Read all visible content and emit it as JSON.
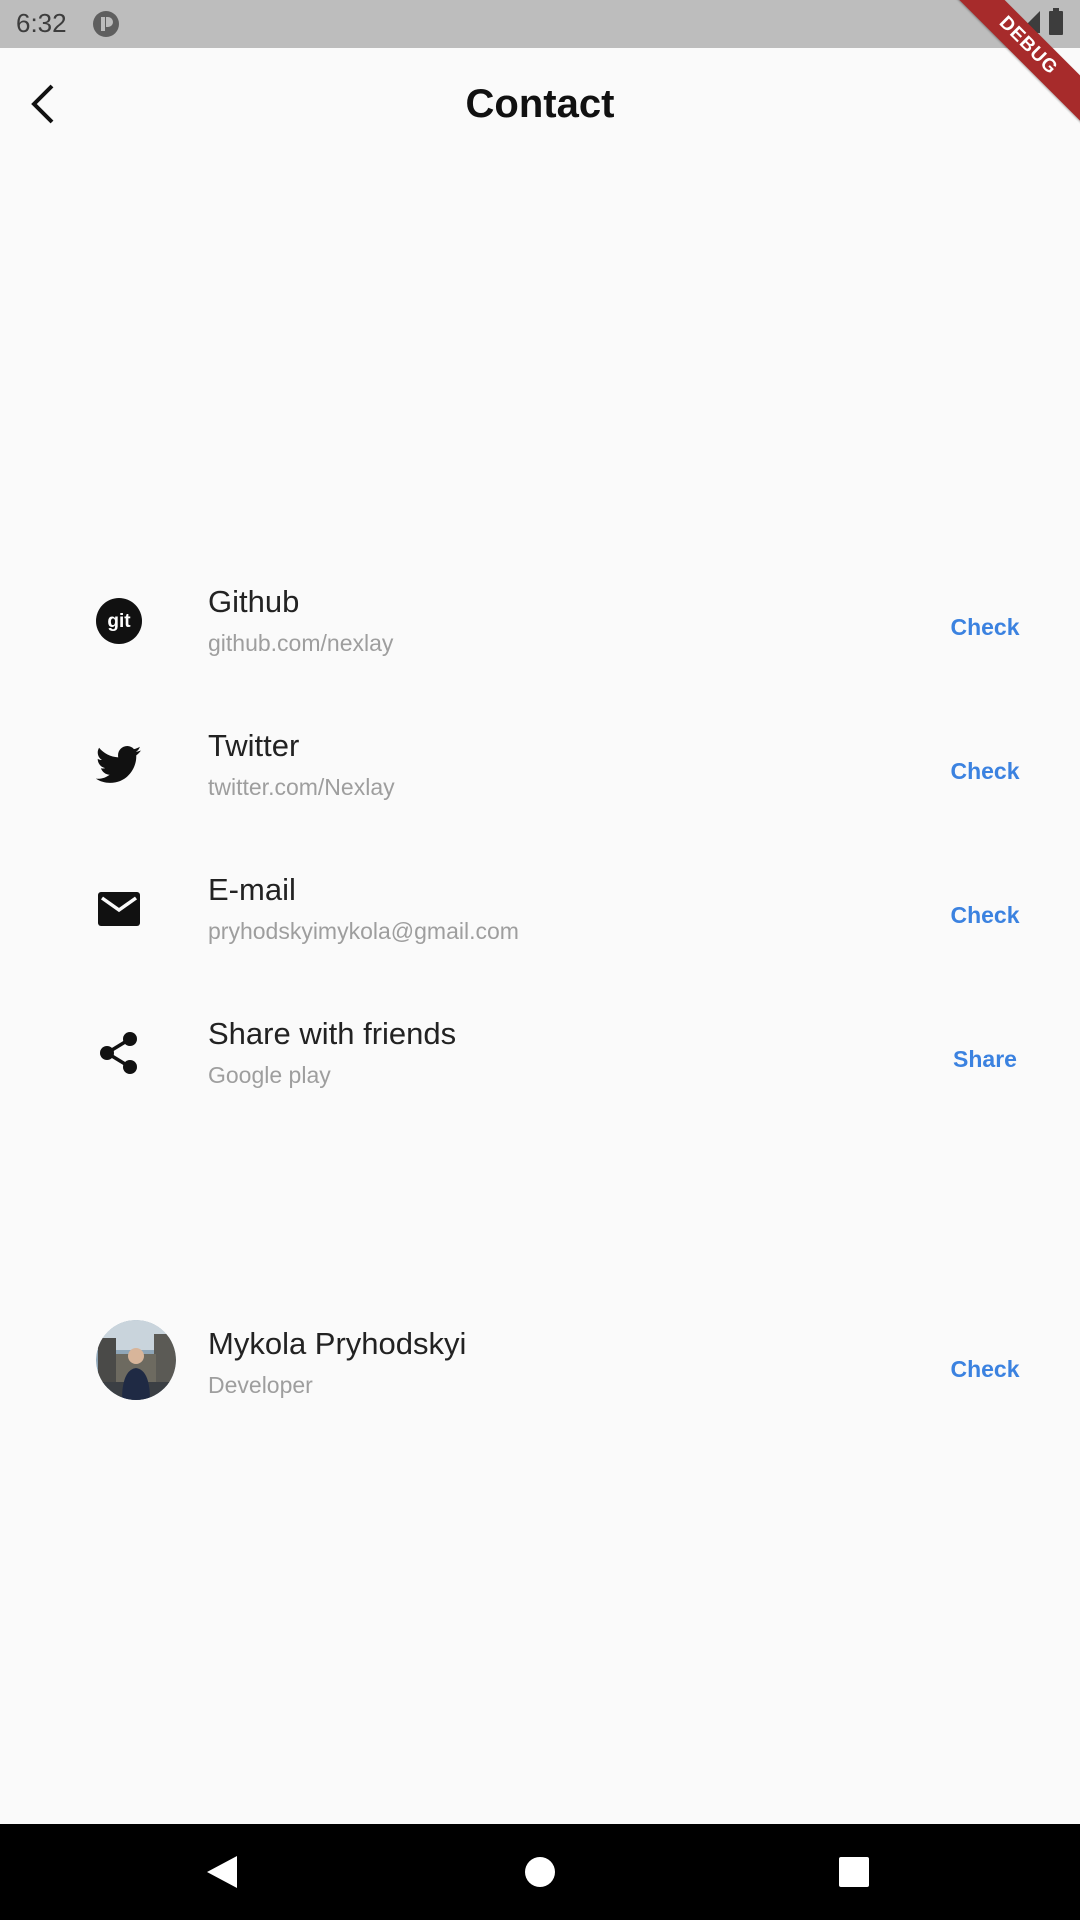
{
  "status_bar": {
    "time": "6:32"
  },
  "debug_banner": {
    "label": "DEBUG"
  },
  "app_bar": {
    "title": "Contact"
  },
  "contacts": [
    {
      "icon": "github-icon",
      "title": "Github",
      "subtitle": "github.com/nexlay",
      "action": "Check"
    },
    {
      "icon": "twitter-icon",
      "title": "Twitter",
      "subtitle": "twitter.com/Nexlay",
      "action": "Check"
    },
    {
      "icon": "mail-icon",
      "title": "E-mail",
      "subtitle": "pryhodskyimykola@gmail.com",
      "action": "Check"
    },
    {
      "icon": "share-icon",
      "title": "Share with friends",
      "subtitle": "Google play",
      "action": "Share"
    }
  ],
  "developer": {
    "name": "Mykola Pryhodskyi",
    "role": "Developer",
    "action": "Check"
  },
  "colors": {
    "accent": "#3b82e0",
    "background": "#fafafa",
    "status_bar": "#bdbdbd",
    "debug_ribbon": "#a72b2b"
  }
}
